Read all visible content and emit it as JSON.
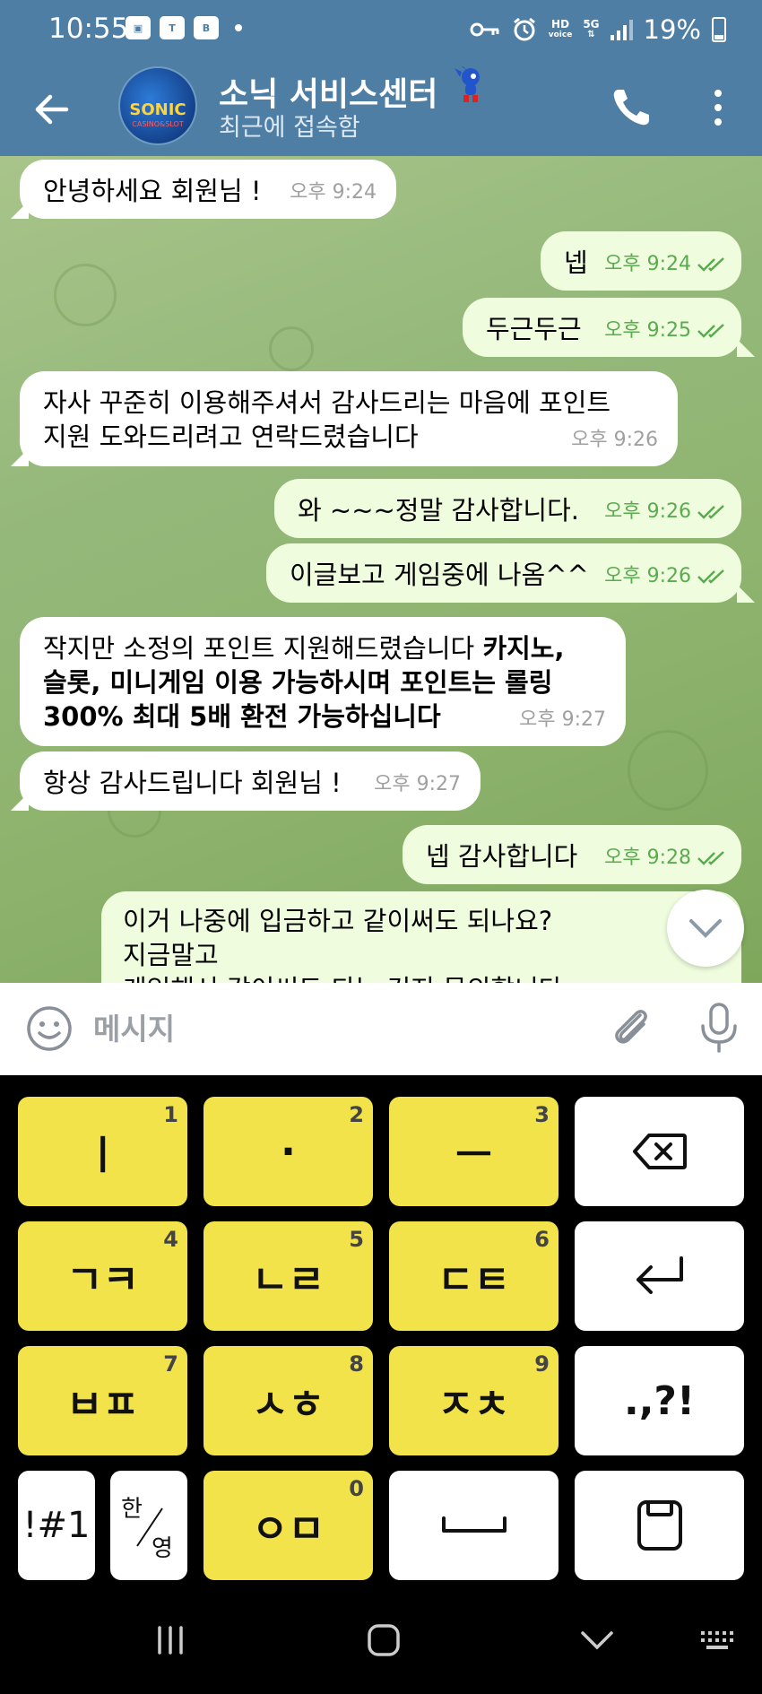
{
  "status_bar": {
    "time": "10:55",
    "left_icons": [
      "gallery-icon",
      "talk-icon",
      "b-icon"
    ],
    "right_icons": [
      "key-icon",
      "alarm-icon",
      "hd-voice-icon",
      "5g-icon",
      "signal-icon"
    ],
    "hd_label": "HD",
    "voice_label": "voice",
    "net_label": "5G",
    "battery": "19%"
  },
  "header": {
    "title": "소닉 서비스센터",
    "status": "최근에 접속함",
    "avatar_text": "SONIC",
    "avatar_sub": "CASINO&SLOT"
  },
  "messages": [
    {
      "dir": "in",
      "text": "안녕하세요 회원님 !",
      "time": "오후 9:24"
    },
    {
      "dir": "out",
      "text": "넵",
      "time": "오후 9:24"
    },
    {
      "dir": "out",
      "text": "두근두근",
      "time": "오후 9:25"
    },
    {
      "dir": "in",
      "text_line1": "자사 꾸준히 이용해주셔서 감사드리는 마음에 포인트",
      "text_line2": "지원 도와드리려고 연락드렸습니다",
      "time": "오후 9:26"
    },
    {
      "dir": "out",
      "text": "와 ~~~정말 감사합니다.",
      "time": "오후 9:26"
    },
    {
      "dir": "out",
      "text": "이글보고 게임중에 나옴^^",
      "time": "오후 9:26"
    },
    {
      "dir": "in",
      "text_plain": "작지만 소정의 포인트 지원해드렸습니다 ",
      "text_bold1": "카지노,",
      "text_bold2": "슬롯, 미니게임 이용 가능하시며  포인트는 롤링",
      "text_bold3": "300% 최대 5배 환전 가능하십니다",
      "time": "오후 9:27"
    },
    {
      "dir": "in",
      "text": "항상 감사드립니다 회원님 !",
      "time": "오후 9:27"
    },
    {
      "dir": "out",
      "text": "넵 감사합니다",
      "time": "오후 9:28"
    },
    {
      "dir": "out",
      "text_line1": "이거 나중에 입금하고 같이써도 되나요?",
      "text_line2": "지금말고",
      "text_line3": "게임해서 같이써도 되는 건지 문의합니다"
    }
  ],
  "input": {
    "placeholder": "메시지"
  },
  "keyboard": {
    "rows": [
      [
        {
          "label": "ㅣ",
          "num": "1"
        },
        {
          "label": "·",
          "num": "2"
        },
        {
          "label": "ㅡ",
          "num": "3"
        },
        {
          "label": "backspace-icon"
        }
      ],
      [
        {
          "label": "ㄱㅋ",
          "num": "4"
        },
        {
          "label": "ㄴㄹ",
          "num": "5"
        },
        {
          "label": "ㄷㅌ",
          "num": "6"
        },
        {
          "label": "enter-icon"
        }
      ],
      [
        {
          "label": "ㅂㅍ",
          "num": "7"
        },
        {
          "label": "ㅅㅎ",
          "num": "8"
        },
        {
          "label": "ㅈㅊ",
          "num": "9"
        },
        {
          "label": ".,?!"
        }
      ],
      [
        {
          "label": "!#1"
        },
        {
          "label_top": "한",
          "label_bottom": "영"
        },
        {
          "label": "ㅇㅁ",
          "num": "0"
        },
        {
          "label": "space-icon"
        },
        {
          "label": "clipboard-icon"
        }
      ]
    ]
  },
  "nav": [
    "recent-apps-icon",
    "home-icon",
    "back-chevron-icon",
    "keyboard-icon"
  ],
  "colors": {
    "header": "#4f7ea5",
    "bubble_out": "#effdde",
    "bubble_in": "#ffffff",
    "time_out": "#5aab4f",
    "key_yellow": "#f2e34a"
  }
}
